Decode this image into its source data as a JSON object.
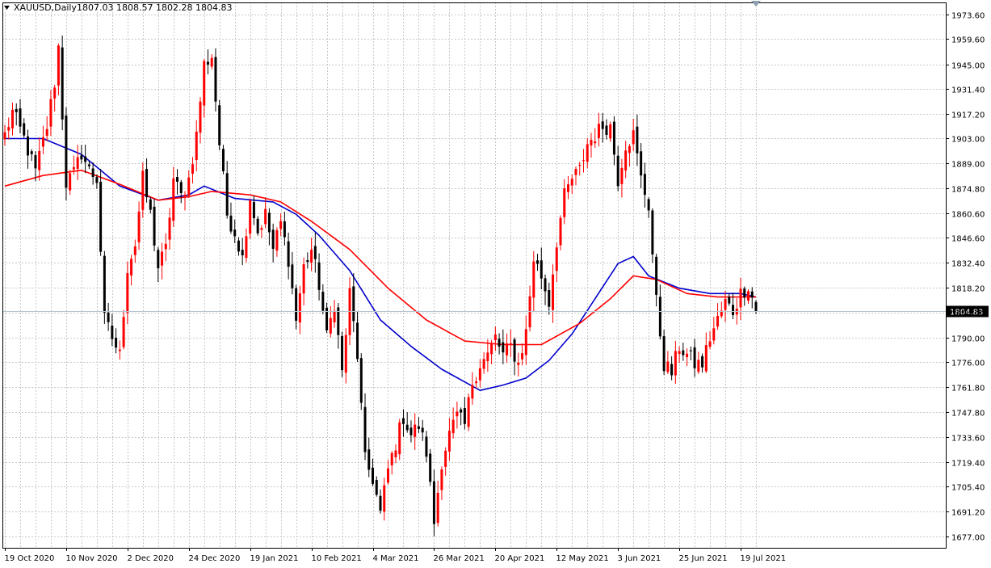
{
  "header": {
    "symbol_timeframe": "XAUUSD,Daily",
    "ohlc_values": "1807.03 1808.57 1802.28 1804.83"
  },
  "colors": {
    "background": "#ffffff",
    "grid": "#c8c8c8",
    "frame": "#000000",
    "bull_candle": "#ff0000",
    "bear_candle": "#000000",
    "ma_blue": "#0000cc",
    "ma_red": "#ff0000",
    "price_line": "#b4c3cd",
    "price_label_bg": "#000000",
    "price_label_text": "#ffffff"
  },
  "chart_data": {
    "type": "candlestick",
    "symbol": "XAUUSD",
    "timeframe": "Daily",
    "current_price": 1804.83,
    "current_price_label": "1804.83",
    "ylim": [
      1670.6,
      1980.3
    ],
    "y_ticks": [
      "1973.60",
      "1959.60",
      "1945.00",
      "1931.40",
      "1917.20",
      "1903.00",
      "1889.00",
      "1874.80",
      "1860.60",
      "1846.60",
      "1832.40",
      "1818.20",
      "1804.00",
      "1790.00",
      "1776.00",
      "1761.80",
      "1747.80",
      "1733.60",
      "1719.40",
      "1705.40",
      "1691.20",
      "1677.00"
    ],
    "x_ticks": [
      "19 Oct 2020",
      "10 Nov 2020",
      "2 Dec 2020",
      "24 Dec 2020",
      "19 Jan 2021",
      "10 Feb 2021",
      "4 Mar 2021",
      "26 Mar 2021",
      "20 Apr 2021",
      "12 May 2021",
      "3 Jun 2021",
      "25 Jun 2021",
      "19 Jul 2021"
    ],
    "x_tick_bar_index": [
      0,
      16,
      32,
      48,
      64,
      80,
      96,
      112,
      128,
      144,
      160,
      176,
      192
    ],
    "bar_count": 197,
    "anchors": [
      [
        0,
        1905
      ],
      [
        2,
        1918
      ],
      [
        5,
        1903
      ],
      [
        8,
        1884
      ],
      [
        11,
        1910
      ],
      [
        13,
        1935
      ],
      [
        14,
        1955
      ],
      [
        16,
        1878
      ],
      [
        18,
        1883
      ],
      [
        20,
        1895
      ],
      [
        22,
        1885
      ],
      [
        24,
        1880
      ],
      [
        26,
        1800
      ],
      [
        28,
        1790
      ],
      [
        30,
        1780
      ],
      [
        32,
        1830
      ],
      [
        34,
        1843
      ],
      [
        36,
        1880
      ],
      [
        38,
        1860
      ],
      [
        40,
        1830
      ],
      [
        42,
        1840
      ],
      [
        44,
        1880
      ],
      [
        46,
        1870
      ],
      [
        48,
        1880
      ],
      [
        50,
        1905
      ],
      [
        52,
        1945
      ],
      [
        54,
        1950
      ],
      [
        56,
        1900
      ],
      [
        58,
        1860
      ],
      [
        60,
        1850
      ],
      [
        62,
        1835
      ],
      [
        64,
        1870
      ],
      [
        66,
        1850
      ],
      [
        68,
        1860
      ],
      [
        70,
        1840
      ],
      [
        72,
        1855
      ],
      [
        74,
        1835
      ],
      [
        76,
        1800
      ],
      [
        78,
        1830
      ],
      [
        80,
        1840
      ],
      [
        82,
        1820
      ],
      [
        84,
        1790
      ],
      [
        86,
        1810
      ],
      [
        88,
        1770
      ],
      [
        90,
        1815
      ],
      [
        92,
        1780
      ],
      [
        94,
        1720
      ],
      [
        96,
        1710
      ],
      [
        98,
        1690
      ],
      [
        100,
        1715
      ],
      [
        102,
        1730
      ],
      [
        104,
        1745
      ],
      [
        106,
        1735
      ],
      [
        108,
        1740
      ],
      [
        110,
        1725
      ],
      [
        112,
        1685
      ],
      [
        114,
        1720
      ],
      [
        116,
        1735
      ],
      [
        118,
        1745
      ],
      [
        120,
        1740
      ],
      [
        122,
        1765
      ],
      [
        124,
        1775
      ],
      [
        126,
        1780
      ],
      [
        128,
        1790
      ],
      [
        130,
        1780
      ],
      [
        132,
        1785
      ],
      [
        134,
        1775
      ],
      [
        136,
        1793
      ],
      [
        138,
        1835
      ],
      [
        140,
        1825
      ],
      [
        142,
        1810
      ],
      [
        144,
        1845
      ],
      [
        146,
        1870
      ],
      [
        148,
        1880
      ],
      [
        150,
        1885
      ],
      [
        152,
        1900
      ],
      [
        154,
        1905
      ],
      [
        156,
        1910
      ],
      [
        158,
        1910
      ],
      [
        160,
        1880
      ],
      [
        162,
        1900
      ],
      [
        164,
        1905
      ],
      [
        166,
        1880
      ],
      [
        168,
        1865
      ],
      [
        170,
        1810
      ],
      [
        172,
        1775
      ],
      [
        174,
        1770
      ],
      [
        176,
        1785
      ],
      [
        178,
        1780
      ],
      [
        180,
        1775
      ],
      [
        182,
        1775
      ],
      [
        184,
        1790
      ],
      [
        186,
        1800
      ],
      [
        188,
        1810
      ],
      [
        190,
        1805
      ],
      [
        192,
        1815
      ],
      [
        194,
        1820
      ],
      [
        196,
        1805.5
      ]
    ],
    "series": [
      {
        "name": "MA blue",
        "values": [
          [
            0,
            1903
          ],
          [
            10,
            1903
          ],
          [
            20,
            1894
          ],
          [
            30,
            1876
          ],
          [
            40,
            1868
          ],
          [
            48,
            1871
          ],
          [
            52,
            1876
          ],
          [
            60,
            1869
          ],
          [
            70,
            1867
          ],
          [
            76,
            1860
          ],
          [
            82,
            1848
          ],
          [
            90,
            1828
          ],
          [
            98,
            1800
          ],
          [
            106,
            1785
          ],
          [
            114,
            1772
          ],
          [
            124,
            1760
          ],
          [
            130,
            1763
          ],
          [
            136,
            1767
          ],
          [
            142,
            1777
          ],
          [
            148,
            1792
          ],
          [
            154,
            1812
          ],
          [
            160,
            1832
          ],
          [
            164,
            1836
          ],
          [
            168,
            1825
          ],
          [
            176,
            1818
          ],
          [
            184,
            1815
          ],
          [
            192,
            1815
          ],
          [
            196,
            1813
          ]
        ]
      },
      {
        "name": "MA red",
        "values": [
          [
            0,
            1876
          ],
          [
            10,
            1882
          ],
          [
            20,
            1885
          ],
          [
            30,
            1877
          ],
          [
            40,
            1868
          ],
          [
            48,
            1870
          ],
          [
            54,
            1873
          ],
          [
            64,
            1871
          ],
          [
            72,
            1867
          ],
          [
            80,
            1856
          ],
          [
            90,
            1840
          ],
          [
            100,
            1818
          ],
          [
            110,
            1800
          ],
          [
            120,
            1788
          ],
          [
            130,
            1786
          ],
          [
            140,
            1786
          ],
          [
            150,
            1798
          ],
          [
            158,
            1812
          ],
          [
            164,
            1825
          ],
          [
            170,
            1823
          ],
          [
            178,
            1815
          ],
          [
            186,
            1813
          ],
          [
            196,
            1813
          ]
        ]
      }
    ]
  }
}
